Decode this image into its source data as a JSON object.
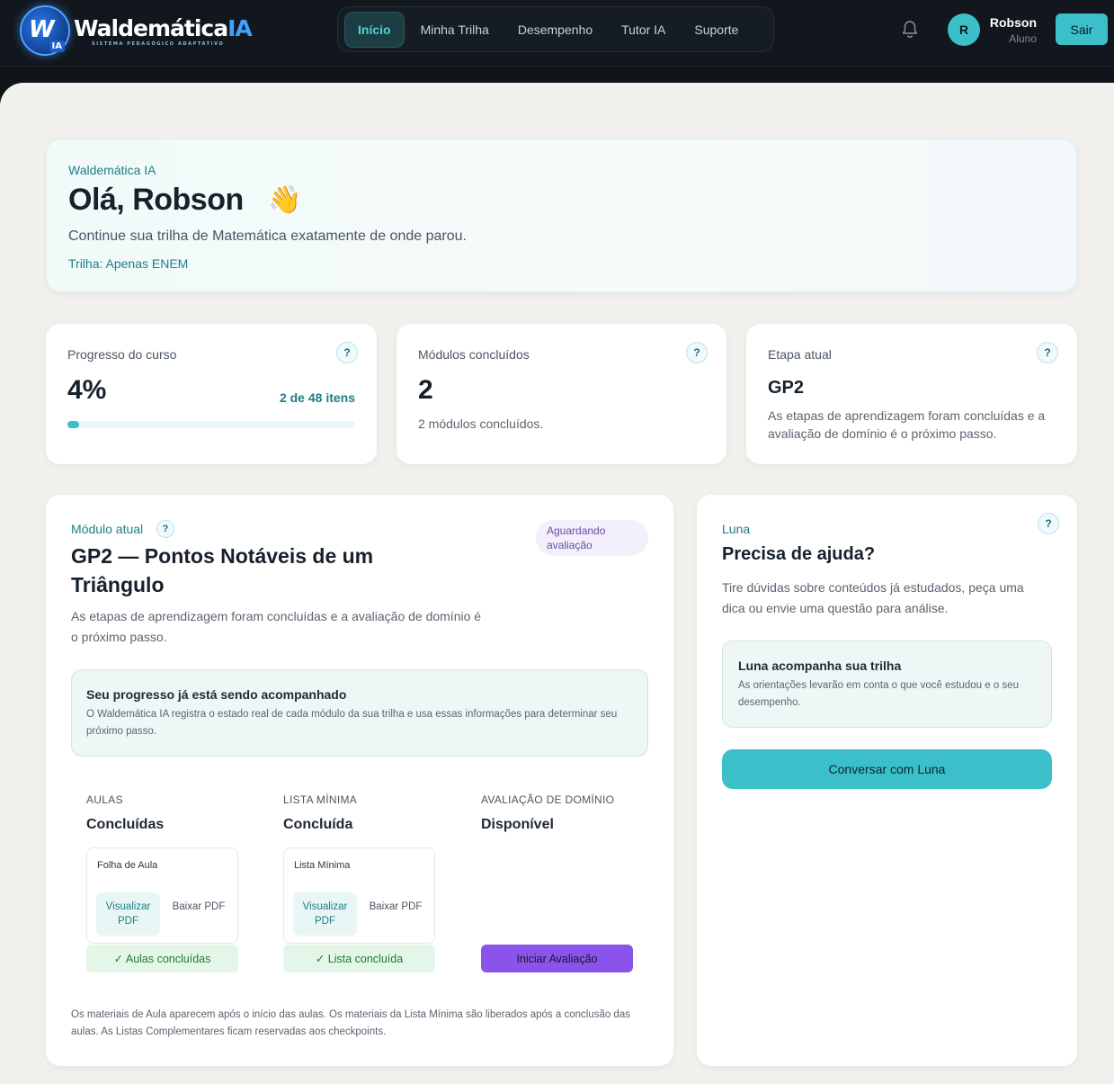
{
  "nav": {
    "logo": {
      "name": "Waldemática",
      "name_accent": "IA",
      "tagline": "SISTEMA PEDAGÓGICO ADAPTATIVO",
      "badge_ia": "IA"
    },
    "tabs": [
      {
        "label": "Início",
        "active": true
      },
      {
        "label": "Minha Trilha",
        "active": false
      },
      {
        "label": "Desempenho",
        "active": false
      },
      {
        "label": "Tutor IA",
        "active": false
      },
      {
        "label": "Suporte",
        "active": false
      }
    ],
    "user": {
      "initial": "R",
      "name": "Robson",
      "role": "Aluno"
    },
    "logout_label": "Sair"
  },
  "hero": {
    "brand": "Waldemática IA",
    "greeting": "Olá, Robson",
    "emoji": "👋",
    "subtitle": "Continue sua trilha de Matemática exatamente de onde parou.",
    "trail": "Trilha: Apenas ENEM"
  },
  "stats": {
    "progress": {
      "label": "Progresso do curso",
      "value": "4%",
      "items": "2 de 48 itens",
      "fraction": 0.04
    },
    "modules": {
      "label": "Módulos concluídos",
      "value": "2",
      "desc": "2 módulos concluídos."
    },
    "stage": {
      "label": "Etapa atual",
      "value": "GP2",
      "desc": "As etapas de aprendizagem foram concluídas e a avaliação de domínio é o próximo passo."
    }
  },
  "help_symbol": "?",
  "module": {
    "kicker": "Módulo atual",
    "title": "GP2 — Pontos Notáveis de um Triângulo",
    "desc": "As etapas de aprendizagem foram concluídas e a avaliação de domínio é o próximo passo.",
    "badge": "Aguardando avaliação",
    "tracking": {
      "title": "Seu progresso já está sendo acompanhado",
      "text": "O Waldemática IA registra o estado real de cada módulo da sua trilha e usa essas informações para determinar seu próximo passo."
    },
    "columns": {
      "aulas": {
        "caption": "AULAS",
        "status": "Concluídas",
        "file": "Folha de Aula",
        "view": "Visualizar PDF",
        "download": "Baixar PDF",
        "done": "✓ Aulas concluídas"
      },
      "lista": {
        "caption": "LISTA MÍNIMA",
        "status": "Concluída",
        "file": "Lista Mínima",
        "view": "Visualizar PDF",
        "download": "Baixar PDF",
        "done": "✓ Lista concluída"
      },
      "avaliacao": {
        "caption": "AVALIAÇÃO DE DOMÍNIO",
        "status": "Disponível",
        "action": "Iniciar Avaliação"
      }
    },
    "footnote": "Os materiais de Aula aparecem após o início das aulas. Os materiais da Lista Mínima são liberados após a conclusão das aulas. As Listas Complementares ficam reservadas aos checkpoints."
  },
  "luna": {
    "kicker": "Luna",
    "title": "Precisa de ajuda?",
    "desc": "Tire dúvidas sobre conteúdos já estudados, peça uma dica ou envie uma questão para análise.",
    "box_title": "Luna acompanha sua trilha",
    "box_text": "As orientações levarão em conta o que você estudou e o seu desempenho.",
    "cta": "Conversar com Luna"
  }
}
